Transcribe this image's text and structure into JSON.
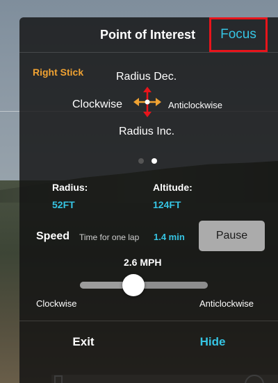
{
  "panel": {
    "title": "Point of Interest",
    "focus_label": "Focus"
  },
  "stick_help": {
    "stick_label": "Right Stick",
    "up": "Radius Dec.",
    "down": "Radius Inc.",
    "left": "Clockwise",
    "right": "Anticlockwise"
  },
  "pager": {
    "pages": 2,
    "active": 2
  },
  "stats": {
    "radius_label": "Radius:",
    "radius_value": "52FT",
    "altitude_label": "Altitude:",
    "altitude_value": "124FT"
  },
  "speed": {
    "label": "Speed",
    "lap_label": "Time for one lap",
    "lap_value": "1.4 min",
    "pause_label": "Pause",
    "mph_value": "2.6 MPH",
    "slider_fraction": 0.42,
    "left_label": "Clockwise",
    "right_label": "Anticlockwise"
  },
  "footer": {
    "exit_label": "Exit",
    "hide_label": "Hide"
  },
  "colors": {
    "accent_blue": "#36c5e4",
    "stick_orange": "#f0a232",
    "stick_red": "#e8141b",
    "highlight_border": "#e8141b"
  },
  "icons": {
    "stick": "four-way-arrows-icon"
  }
}
